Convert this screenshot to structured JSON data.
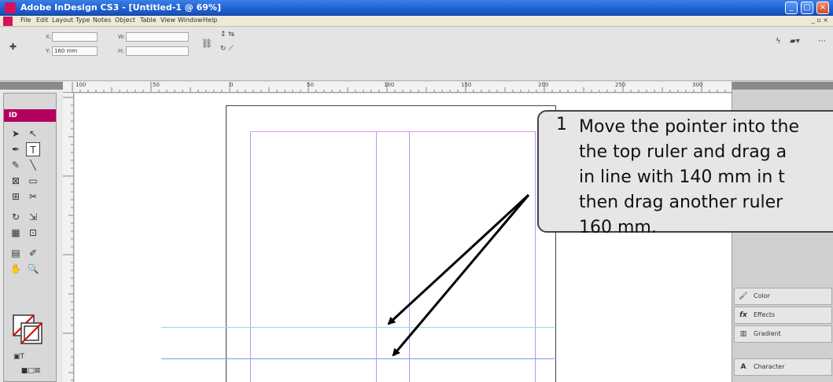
{
  "window": {
    "title": "Adobe InDesign CS3 - [Untitled-1 @ 69%]"
  },
  "menu": [
    "File",
    "Edit",
    "Layout",
    "Type",
    "Notes",
    "Object",
    "Table",
    "View",
    "Window",
    "Help"
  ],
  "control_panel": {
    "x_label": "X:",
    "y_label": "Y:",
    "w_label": "W:",
    "h_label": "H:",
    "y_value": "160 mm"
  },
  "ruler": {
    "top_numbers": [
      "100",
      "50",
      "0",
      "50",
      "100",
      "150",
      "200",
      "250",
      "300"
    ]
  },
  "tools": {
    "logo": "ID"
  },
  "panels": {
    "items": [
      "Color",
      "Effects",
      "Gradient",
      "Character"
    ]
  },
  "callout": {
    "number": "1",
    "text": "Move the pointer into the\nthe top ruler and drag a\nin line with 140 mm in t\nthen drag another ruler\n160 mm."
  },
  "colors": {
    "guide_cyan": "#7fe3ee",
    "guide_blue": "#7b9fe0",
    "margin_magenta": "#e493e8",
    "column_purple": "#b59ae8"
  }
}
